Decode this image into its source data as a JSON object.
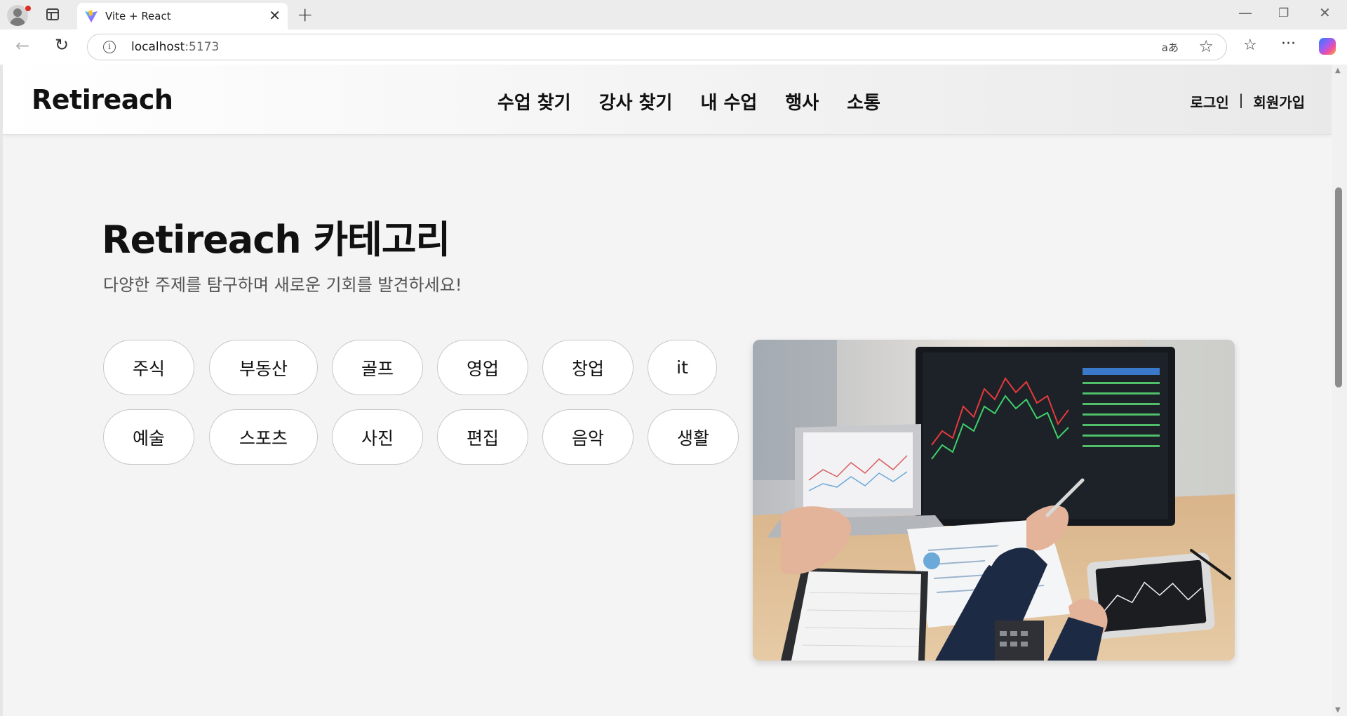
{
  "browser": {
    "tab_title": "Vite + React",
    "url_host": "localhost",
    "url_port": ":5173",
    "read_aloud": "aあ"
  },
  "site": {
    "logo": "Retireach",
    "nav": [
      "수업 찾기",
      "강사 찾기",
      "내 수업",
      "행사",
      "소통"
    ],
    "login": "로그인",
    "separator": "|",
    "signup": "회원가입"
  },
  "hero": {
    "title": "Retireach 카테고리",
    "subtitle": "다양한 주제를 탐구하며 새로운 기회를 발견하세요!"
  },
  "categories": [
    [
      "주식",
      "부동산",
      "골프",
      "영업",
      "창업",
      "it"
    ],
    [
      "예술",
      "스포츠",
      "사진",
      "편집",
      "음악",
      "생활"
    ]
  ],
  "colors": {
    "page_bg": "#f4f4f4",
    "chip_border": "#c8c8c8",
    "text": "#111111"
  },
  "icons": [
    "profile-icon",
    "tabs-icon",
    "vite-icon",
    "close-icon",
    "plus-icon",
    "back-icon",
    "reload-icon",
    "info-icon",
    "star-icon",
    "favorites-icon",
    "more-icon",
    "copilot-icon"
  ]
}
